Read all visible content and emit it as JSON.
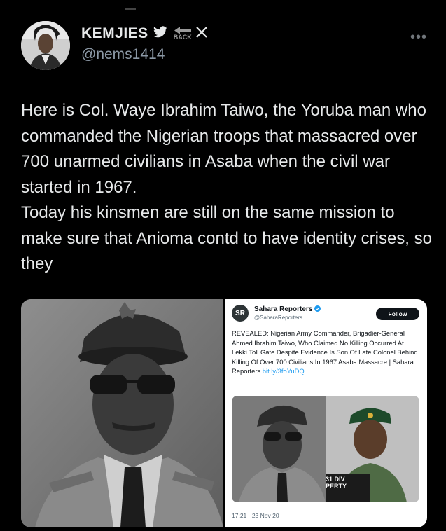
{
  "tweet": {
    "author_name": "KEMJIES",
    "author_handle": "@nems1414",
    "back_label": "BACK",
    "x_label": "X",
    "more_label": "•••",
    "text": "Here is Col. Waye Ibrahim Taiwo, the Yoruba man who commanded the Nigerian troops that massacred over 700 unarmed civilians in Asaba when the civil war started in 1967.\nToday his kinsmen are still on the same mission to make sure that Anioma contd to have identity crises, so they"
  },
  "embedded": {
    "logo_text": "SR",
    "name": "Sahara Reporters",
    "handle": "@SaharaReporters",
    "follow_label": "Follow",
    "text": "REVEALED: Nigerian Army Commander, Brigadier-General Ahmed Ibrahim Taiwo, Who Claimed No Killing Occurred At Lekki Toll Gate Despite Evidence Is Son Of Late Colonel Behind Killing Of Over 700 Civilians In 1967 Asaba Massacre | Sahara Reporters ",
    "link": "bit.ly/3foYuDQ",
    "caption_line1": "31 DIV",
    "caption_line2": "PERTY",
    "time": "17:21 · 23 Nov 20"
  },
  "colors": {
    "background": "#000000",
    "text": "#e7e9ea",
    "muted": "#8b98a5",
    "verified": "#1d9bf0"
  }
}
